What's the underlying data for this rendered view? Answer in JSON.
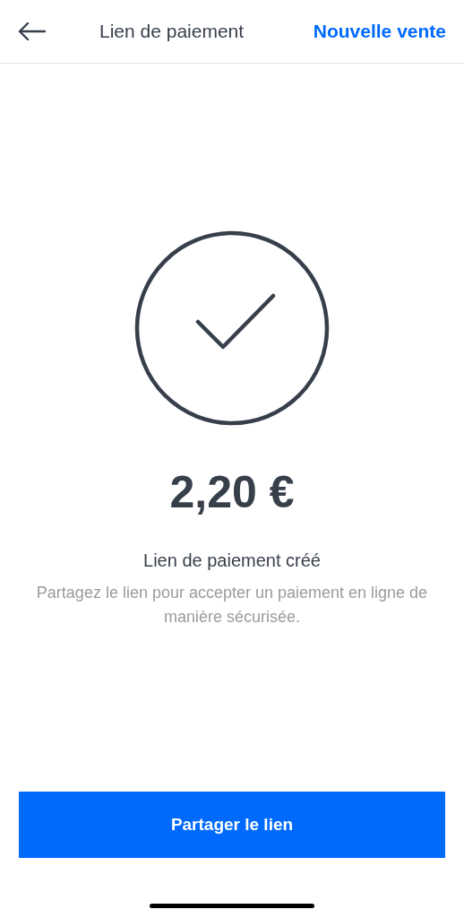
{
  "header": {
    "title": "Lien de paiement",
    "action": "Nouvelle vente"
  },
  "amount": "2,20 €",
  "heading": "Lien de paiement créé",
  "message": "Partagez le lien pour accepter un paiement en ligne de manière sécurisée.",
  "button": "Partager le lien"
}
